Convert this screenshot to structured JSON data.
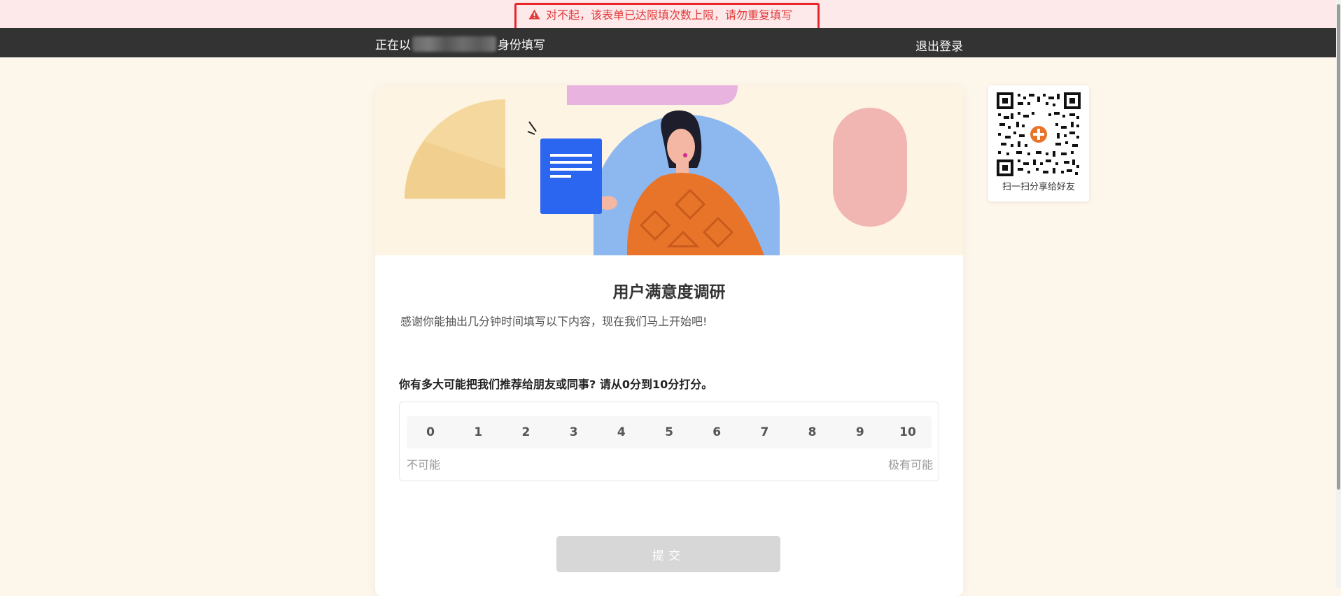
{
  "alert": {
    "message": "对不起，该表单已达限填次数上限，请勿重复填写",
    "icon": "warning-icon",
    "color": "#e23b3b"
  },
  "topbar": {
    "login_prefix": "正在以",
    "login_suffix": "身份填写",
    "logout_label": "退出登录"
  },
  "form": {
    "title": "用户满意度调研",
    "description": "感谢你能抽出几分钟时间填写以下内容，现在我们马上开始吧!",
    "question": {
      "label": "你有多大可能把我们推荐给朋友或同事? 请从0分到10分打分。",
      "scores": [
        "0",
        "1",
        "2",
        "3",
        "4",
        "5",
        "6",
        "7",
        "8",
        "9",
        "10"
      ],
      "low_label": "不可能",
      "high_label": "极有可能"
    },
    "submit_label": "提交"
  },
  "share": {
    "caption": "扫一扫分享给好友"
  },
  "colors": {
    "accent_orange": "#e8742a",
    "document_blue": "#2a66f0",
    "topbar_bg": "#333333"
  }
}
